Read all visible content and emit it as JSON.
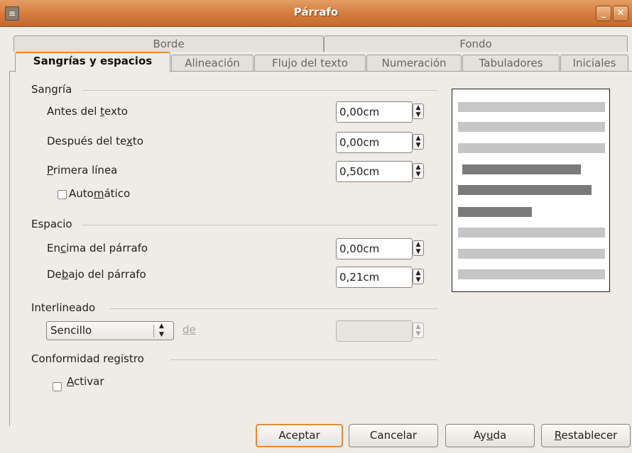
{
  "window": {
    "title": "Párrafo",
    "minimize_glyph": "_",
    "close_glyph": "✕",
    "app_icon": "document-icon"
  },
  "tabs_row1": [
    {
      "label": "Borde"
    },
    {
      "label": "Fondo"
    }
  ],
  "tabs_row2": [
    {
      "label": "Sangrías y espacios",
      "active": true
    },
    {
      "label": "Alineación"
    },
    {
      "label": "Flujo del texto"
    },
    {
      "label": "Numeración"
    },
    {
      "label": "Tabuladores"
    },
    {
      "label": "Iniciales"
    }
  ],
  "indent": {
    "section_label": "Sangría",
    "before_text": {
      "label_pre": "Antes del ",
      "label_u": "t",
      "label_post": "exto",
      "value": "0,00cm"
    },
    "after_text": {
      "label_pre": "Después del te",
      "label_u": "x",
      "label_post": "to",
      "value": "0,00cm"
    },
    "first_line": {
      "label_pre": "",
      "label_u": "P",
      "label_post": "rimera línea",
      "value": "0,50cm"
    },
    "automatic": {
      "label_pre": "Auto",
      "label_u": "m",
      "label_post": "ático",
      "checked": false
    }
  },
  "spacing": {
    "section_label": "Espacio",
    "above": {
      "label_pre": "En",
      "label_u": "c",
      "label_post": "ima del párrafo",
      "value": "0,00cm"
    },
    "below": {
      "label_pre": "De",
      "label_u": "b",
      "label_post": "ajo del párrafo",
      "value": "0,21cm"
    }
  },
  "line_spacing": {
    "section_label": "Interlineado",
    "selected": "Sencillo",
    "of_label": "de",
    "of_value": ""
  },
  "register": {
    "section_label": "Conformidad registro",
    "activate": {
      "label_pre": "",
      "label_u": "A",
      "label_post": "ctivar",
      "checked": false
    }
  },
  "buttons": {
    "ok": "Aceptar",
    "cancel": "Cancelar",
    "help_pre": "Ay",
    "help_u": "u",
    "help_post": "da",
    "reset_pre": "",
    "reset_u": "R",
    "reset_post": "establecer"
  },
  "colors": {
    "accent": "#f08a24",
    "titlebar": "#d47a3c",
    "preview_light": "#c6c6c6",
    "preview_dark": "#7a7a7a"
  }
}
